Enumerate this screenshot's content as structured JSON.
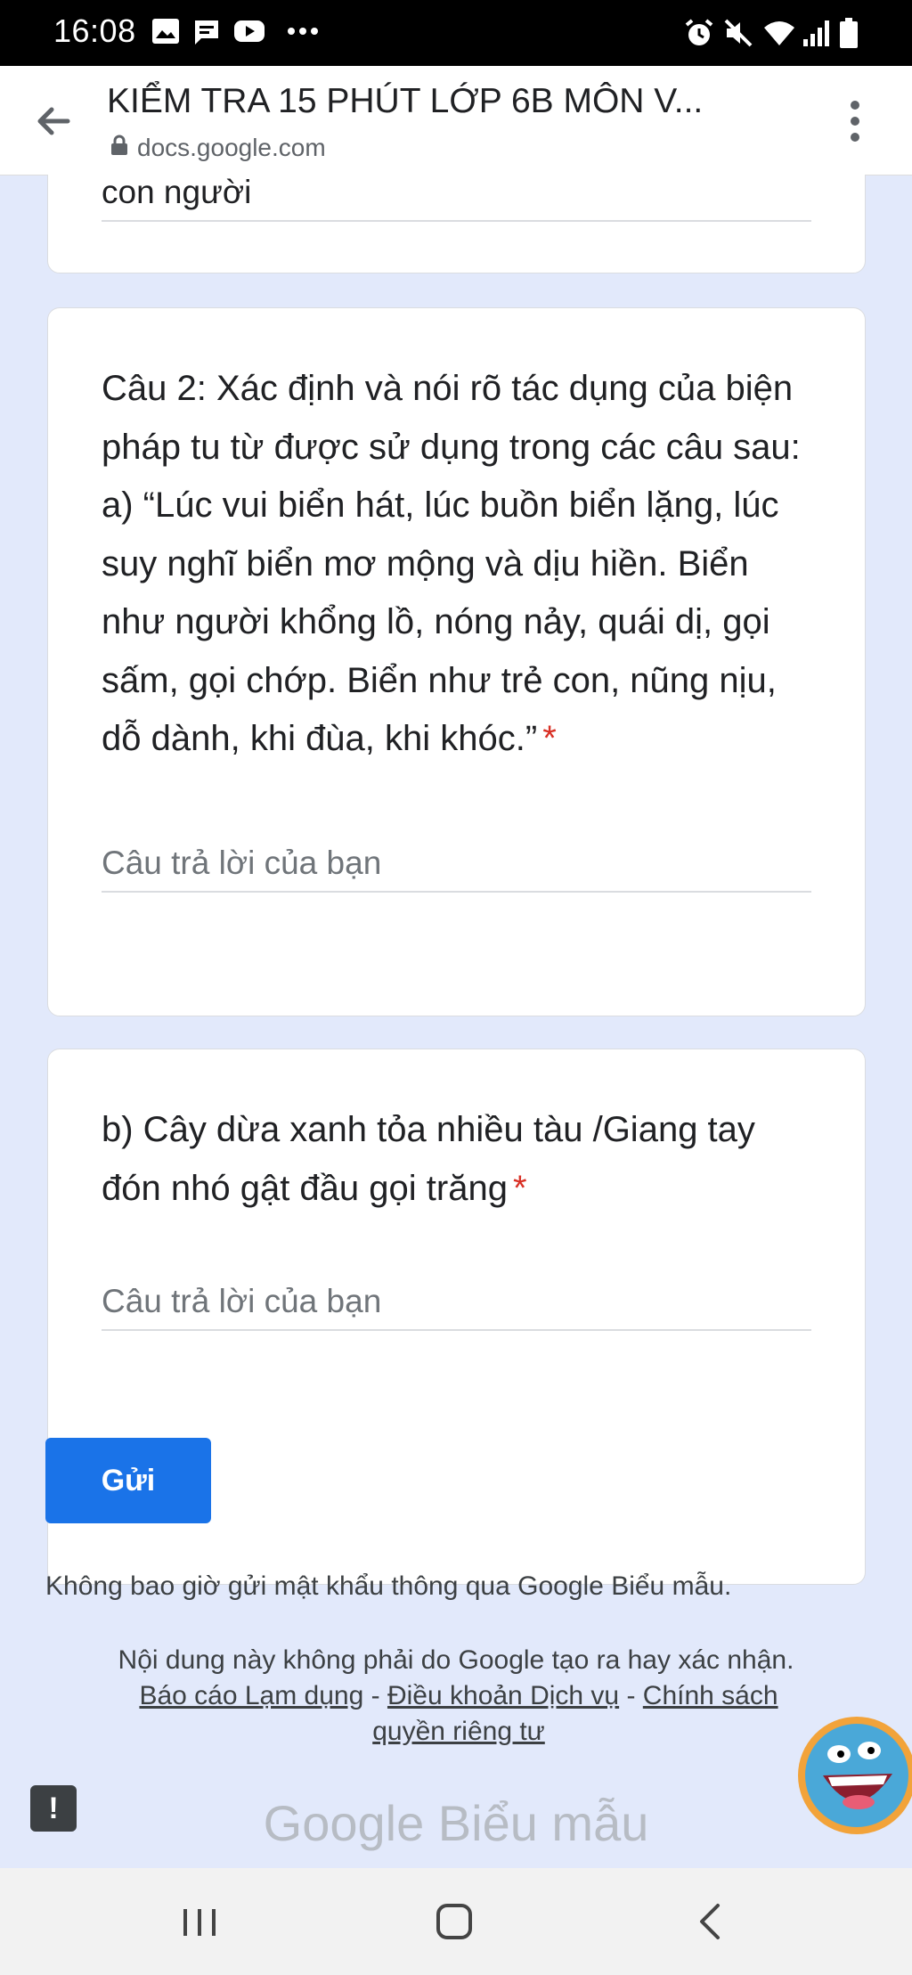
{
  "status_bar": {
    "time": "16:08",
    "left_icons": [
      "image-icon",
      "chat-icon",
      "youtube-icon",
      "more-dots-icon"
    ],
    "right_icons": [
      "alarm-icon",
      "mute-icon",
      "wifi-icon",
      "signal-icon",
      "battery-icon"
    ]
  },
  "toolbar": {
    "title": "KIỂM TRA 15 PHÚT LỚP 6B MÔN V...",
    "url": "docs.google.com"
  },
  "previous_card": {
    "answer_text": "con người"
  },
  "question_2": {
    "text": "Câu 2: Xác định và nói rõ tác dụng của biện pháp tu từ được sử dụng trong các câu sau: a) “Lúc vui biển hát, lúc buồn biển lặng, lúc suy nghĩ biển mơ mộng và dịu hiền. Biển như người khổng lồ, nóng nảy, quái dị, gọi sấm, gọi chớp. Biển như trẻ con, nũng nịu, dỗ dành, khi đùa, khi khóc.”",
    "required_mark": "*",
    "answer_placeholder": "Câu trả lời của bạn"
  },
  "question_b": {
    "text": "b) Cây dừa xanh tỏa nhiều tàu /Giang tay đón nhó gật đầu gọi trăng",
    "required_mark": "*",
    "answer_placeholder": "Câu trả lời của bạn"
  },
  "submit_label": "Gửi",
  "password_warning": "Không bao giờ gửi mật khẩu thông qua Google Biểu mẫu.",
  "footer": {
    "disclaimer": "Nội dung này không phải do Google tạo ra hay xác nhận.",
    "report_abuse": "Báo cáo Lạm dụng",
    "separator1": " - ",
    "terms": "Điều khoản Dịch vụ",
    "separator2": " - ",
    "privacy": "Chính sách quyền riêng tư",
    "logo_text_google": "Google",
    "logo_text_forms": " Biểu mẫu"
  },
  "feedback_label": "!",
  "colors": {
    "page_bg": "#e2e9fb",
    "accent": "#1a73e8",
    "required": "#d93025"
  }
}
